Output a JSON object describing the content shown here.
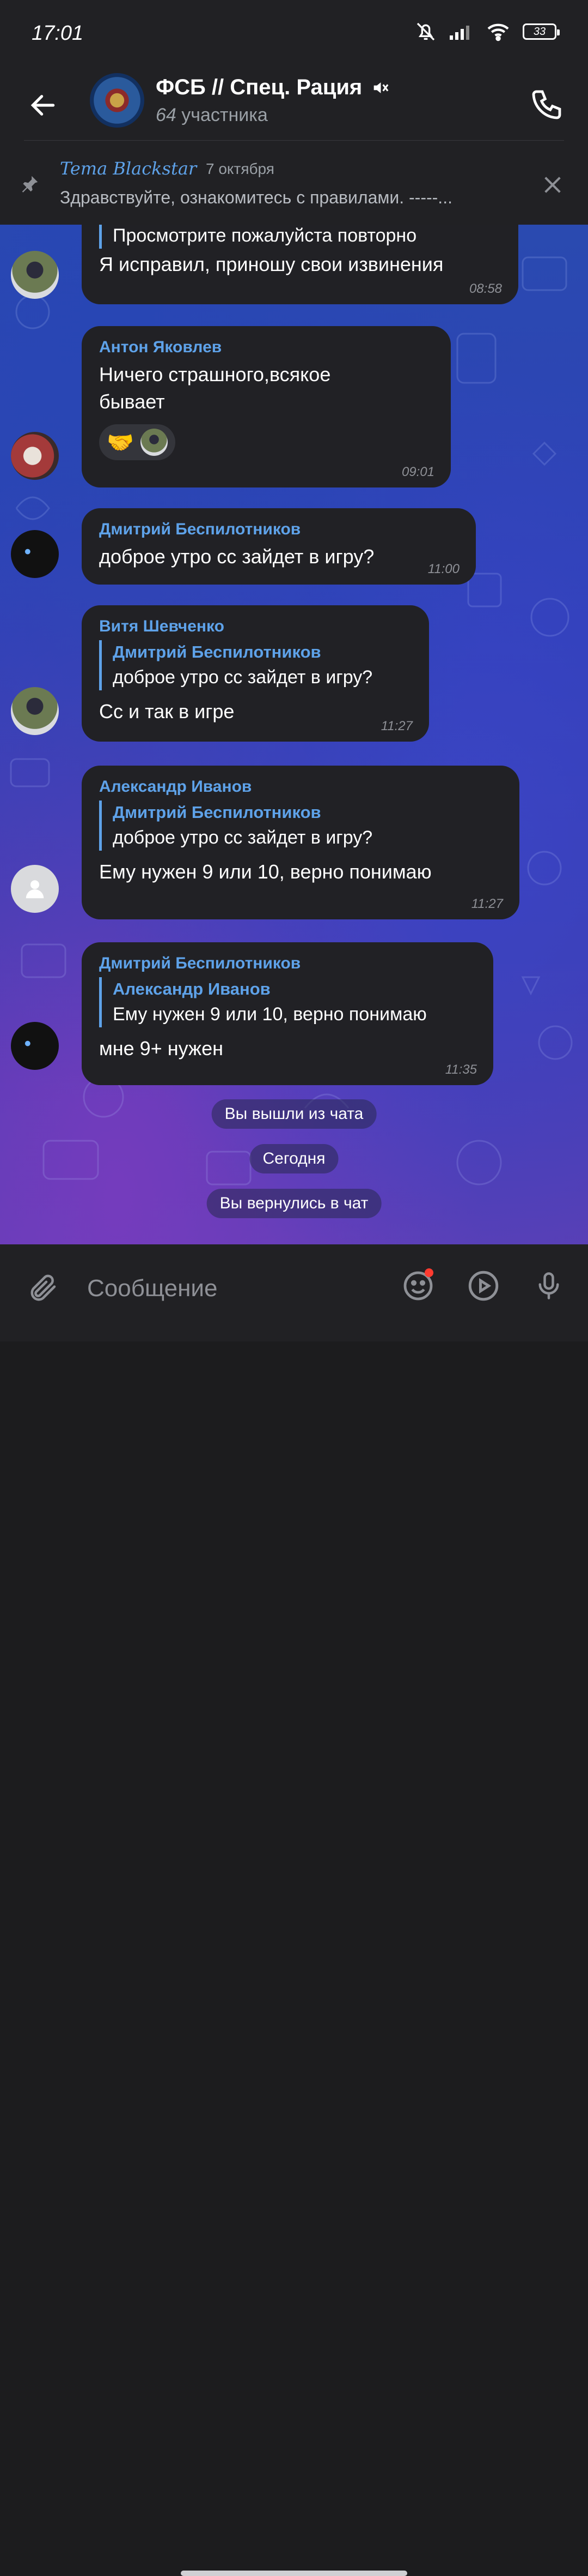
{
  "status": {
    "time": "17:01",
    "battery": "33"
  },
  "header": {
    "title": "ФСБ // Спец. Рация",
    "subtitle_count": "64",
    "subtitle_label": "участника",
    "muted_icon": "mute-icon"
  },
  "pinned": {
    "author": "Tema Blackstar",
    "date": "7 октября",
    "text": "Здравствуйте, ознакомитесь с правилами. -----..."
  },
  "messages": [
    {
      "reply_fragment": "Просмотрите пожалуйста повторно",
      "text": "Я исправил, приношу свои извинения",
      "time": "08:58"
    },
    {
      "sender": "Антон Яковлев",
      "text": "Ничего страшного,всякое бывает",
      "time": "09:01",
      "reaction": "🤝"
    },
    {
      "sender": "Дмитрий Беспилотников",
      "text": "доброе утро сс зайдет в игру?",
      "time": "11:00"
    },
    {
      "sender": "Витя Шевченко",
      "reply_name": "Дмитрий Беспилотников",
      "reply_text": "доброе утро сс зайдет в игру?",
      "text": "Сс и так в игре",
      "time": "11:27"
    },
    {
      "sender": "Александр Иванов",
      "reply_name": "Дмитрий Беспилотников",
      "reply_text": "доброе утро сс зайдет в игру?",
      "text": "Ему нужен 9 или 10, верно понимаю",
      "time": "11:27"
    },
    {
      "sender": "Дмитрий Беспилотников",
      "reply_name": "Александр Иванов",
      "reply_text": "Ему нужен 9 или 10, верно понимаю",
      "text": "мне 9+ нужен",
      "time": "11:35"
    }
  ],
  "service": {
    "left": "Вы вышли из чата",
    "today": "Сегодня",
    "returned": "Вы вернулись в чат"
  },
  "input": {
    "placeholder": "Сообщение"
  },
  "colors": {
    "accent": "#5ea2e9",
    "bubble": "#212125",
    "chrome": "#212124"
  }
}
